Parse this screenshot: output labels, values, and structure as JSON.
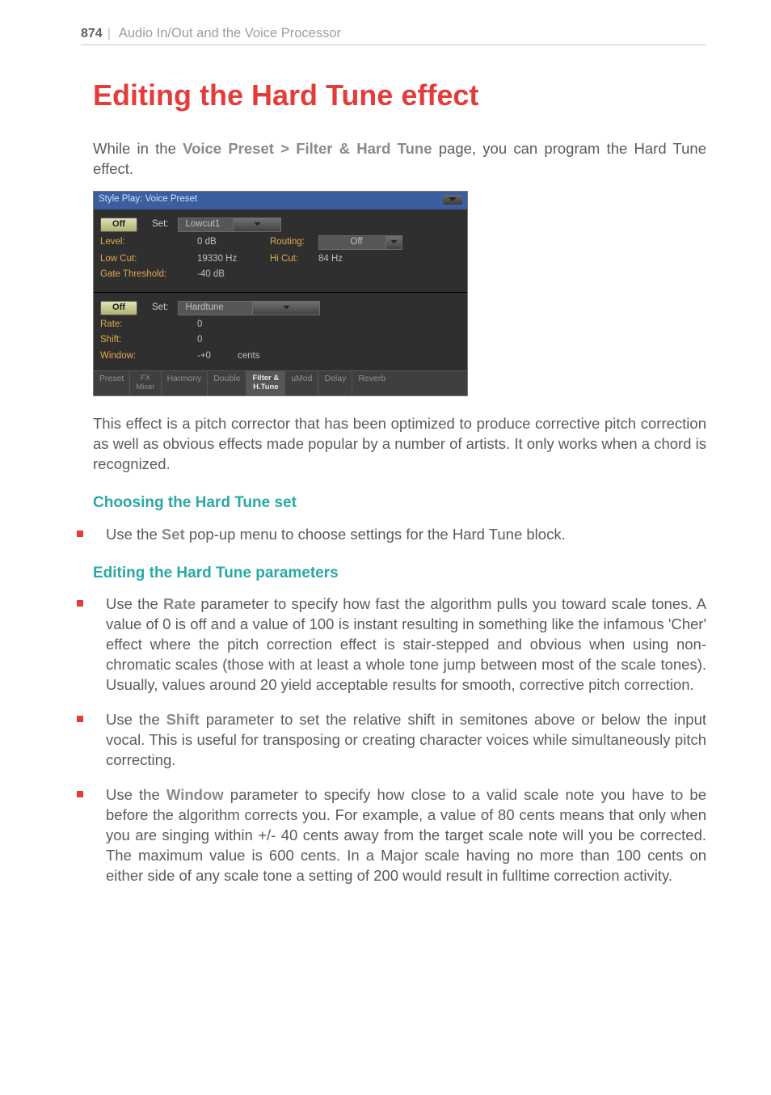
{
  "header": {
    "page_number": "874",
    "divider": "|",
    "section": "Audio In/Out and the Voice Processor"
  },
  "title": "Editing the Hard Tune effect",
  "intro": {
    "pre": "While in the ",
    "kw1": "Voice Preset > Filter & Hard Tune",
    "post": " page, you can program the Hard Tune effect."
  },
  "shot": {
    "titlebar": "Style Play: Voice Preset",
    "upper": {
      "toggle": "Off",
      "set_label": "Set:",
      "set_value": "Lowcut1",
      "level_lbl": "Level:",
      "level_val": "0 dB",
      "routing_lbl": "Routing:",
      "routing_val": "Off",
      "lowcut_lbl": "Low Cut:",
      "lowcut_val": "19330 Hz",
      "hicut_lbl": "Hi Cut:",
      "hicut_val": "84 Hz",
      "gate_lbl": "Gate Threshold:",
      "gate_val": "-40 dB"
    },
    "lower": {
      "toggle": "Off",
      "set_label": "Set:",
      "set_value": "Hardtune",
      "rate_lbl": "Rate:",
      "rate_val": "0",
      "shift_lbl": "Shift:",
      "shift_val": "0",
      "window_lbl": "Window:",
      "window_val": "-+0",
      "window_unit": "cents"
    },
    "tabs": [
      "Preset",
      "FX\nMixer",
      "Harmony",
      "Double",
      "Filter &\nH.Tune",
      "uMod",
      "Delay",
      "Reverb"
    ]
  },
  "desc": "This effect is a pitch corrector that has been optimized to produce corrective pitch correction as well as obvious effects made popular by a number of artists. It only works when a chord is recognized.",
  "h2_set": "Choosing the Hard Tune set",
  "bullet_set": {
    "pre": "Use the ",
    "kw": "Set",
    "post": " pop-up menu to choose settings for the Hard Tune block."
  },
  "h2_params": "Editing the Hard Tune parameters",
  "bullet_rate": {
    "pre": "Use the ",
    "kw": "Rate",
    "post": " parameter to specify how fast the algorithm pulls you toward scale tones. A value of 0 is off and a value of 100 is instant resulting in something like the infamous 'Cher' effect where the pitch correction effect is stair-stepped and obvious when using non-chromatic scales (those with at least a whole tone jump between most of the scale tones). Usually, values around 20 yield acceptable results for smooth, corrective pitch correction."
  },
  "bullet_shift": {
    "pre": "Use the ",
    "kw": "Shift",
    "post": " parameter to set the relative shift in semitones above or below the input vocal. This is useful for transposing or creating character voices while simultaneously pitch correcting."
  },
  "bullet_window": {
    "pre": "Use the ",
    "kw": "Window",
    "post": " parameter to specify how close to a valid scale note you have to be before the algorithm corrects you. For example, a value of 80 cents means that only when you are singing within +/- 40 cents away from the target scale note will you be corrected. The maximum value is 600 cents. In a Major scale having no more than 100 cents on either side of any scale tone a setting of 200 would result in fulltime correction activity."
  }
}
